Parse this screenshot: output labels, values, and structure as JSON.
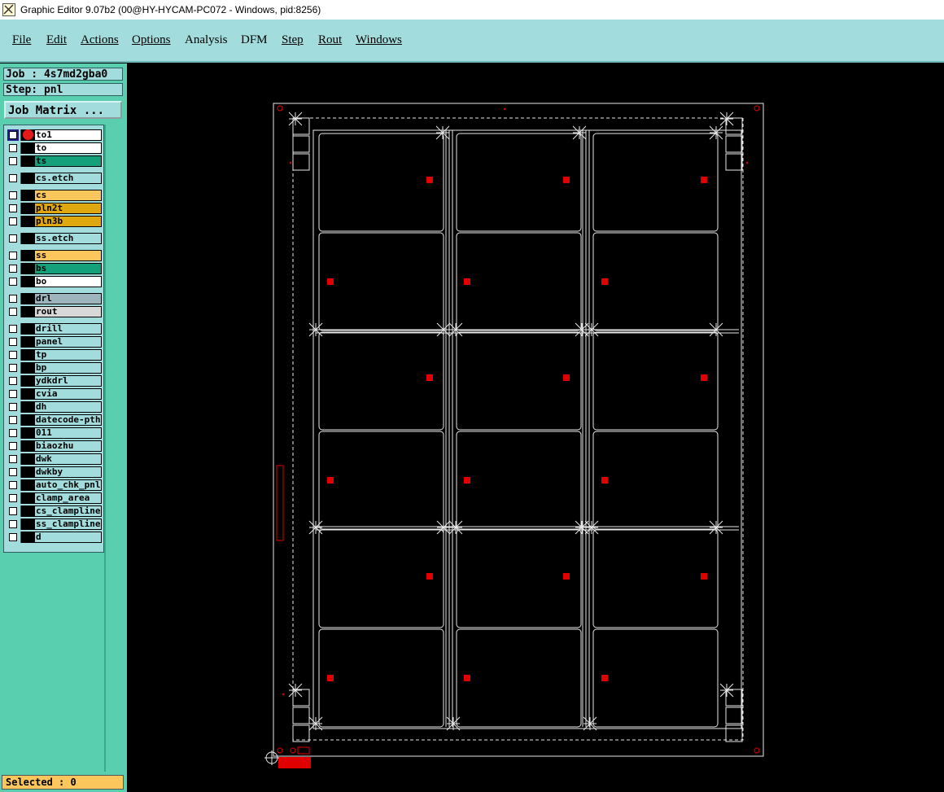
{
  "window": {
    "title": "Graphic Editor 9.07b2 (00@HY-HYCAM-PC072 - Windows, pid:8256)"
  },
  "menu": [
    "File",
    "Edit",
    "Actions",
    "Options",
    "Analysis",
    "DFM",
    "Step",
    "Rout",
    "Windows"
  ],
  "job": {
    "job_label": "Job : 4s7md2gba0",
    "step_label": "Step: pnl",
    "matrix_button": "Job Matrix ..."
  },
  "layers": [
    {
      "name": "to1",
      "color": "#ffffff",
      "group": 0
    },
    {
      "name": "to",
      "color": "#ffffff",
      "group": 0
    },
    {
      "name": "ts",
      "color": "#14a07a",
      "group": 0
    },
    {
      "name": "cs.etch",
      "color": "#a2dcdc",
      "group": 1
    },
    {
      "name": "cs",
      "color": "#fbc65c",
      "group": 2
    },
    {
      "name": "pln2t",
      "color": "#e0a810",
      "group": 2
    },
    {
      "name": "pln3b",
      "color": "#e0a810",
      "group": 2
    },
    {
      "name": "ss.etch",
      "color": "#a2dcdc",
      "group": 3
    },
    {
      "name": "ss",
      "color": "#fbc65c",
      "group": 4
    },
    {
      "name": "bs",
      "color": "#14a07a",
      "group": 4
    },
    {
      "name": "bo",
      "color": "#ffffff",
      "group": 4
    },
    {
      "name": "drl",
      "color": "#9db4bc",
      "group": 5
    },
    {
      "name": "rout",
      "color": "#d8d8d8",
      "group": 5
    },
    {
      "name": "drill",
      "color": "#a2dcdc",
      "group": 6
    },
    {
      "name": "panel",
      "color": "#a2dcdc",
      "group": 6
    },
    {
      "name": "tp",
      "color": "#a2dcdc",
      "group": 6
    },
    {
      "name": "bp",
      "color": "#a2dcdc",
      "group": 6
    },
    {
      "name": "ydkdrl",
      "color": "#a2dcdc",
      "group": 6
    },
    {
      "name": "cvia",
      "color": "#a2dcdc",
      "group": 6
    },
    {
      "name": "dh",
      "color": "#a2dcdc",
      "group": 6
    },
    {
      "name": "datecode-pth",
      "color": "#a2dcdc",
      "group": 6
    },
    {
      "name": "011",
      "color": "#a2dcdc",
      "group": 6
    },
    {
      "name": "biaozhu",
      "color": "#a2dcdc",
      "group": 6
    },
    {
      "name": "dwk",
      "color": "#a2dcdc",
      "group": 6
    },
    {
      "name": "dwkby",
      "color": "#a2dcdc",
      "group": 6
    },
    {
      "name": "auto_chk_pnl",
      "color": "#a2dcdc",
      "group": 6
    },
    {
      "name": "clamp_area",
      "color": "#a2dcdc",
      "group": 6
    },
    {
      "name": "cs_clampline",
      "color": "#a2dcdc",
      "group": 6
    },
    {
      "name": "ss_clampline",
      "color": "#a2dcdc",
      "group": 6
    },
    {
      "name": "d",
      "color": "#a2dcdc",
      "group": 6
    }
  ],
  "status": {
    "selected": "Selected : 0"
  },
  "colors": {
    "menubar": "#a2dcdc",
    "panel": "#59cfb0",
    "canvas": "#000000",
    "marker": "#e00000"
  }
}
